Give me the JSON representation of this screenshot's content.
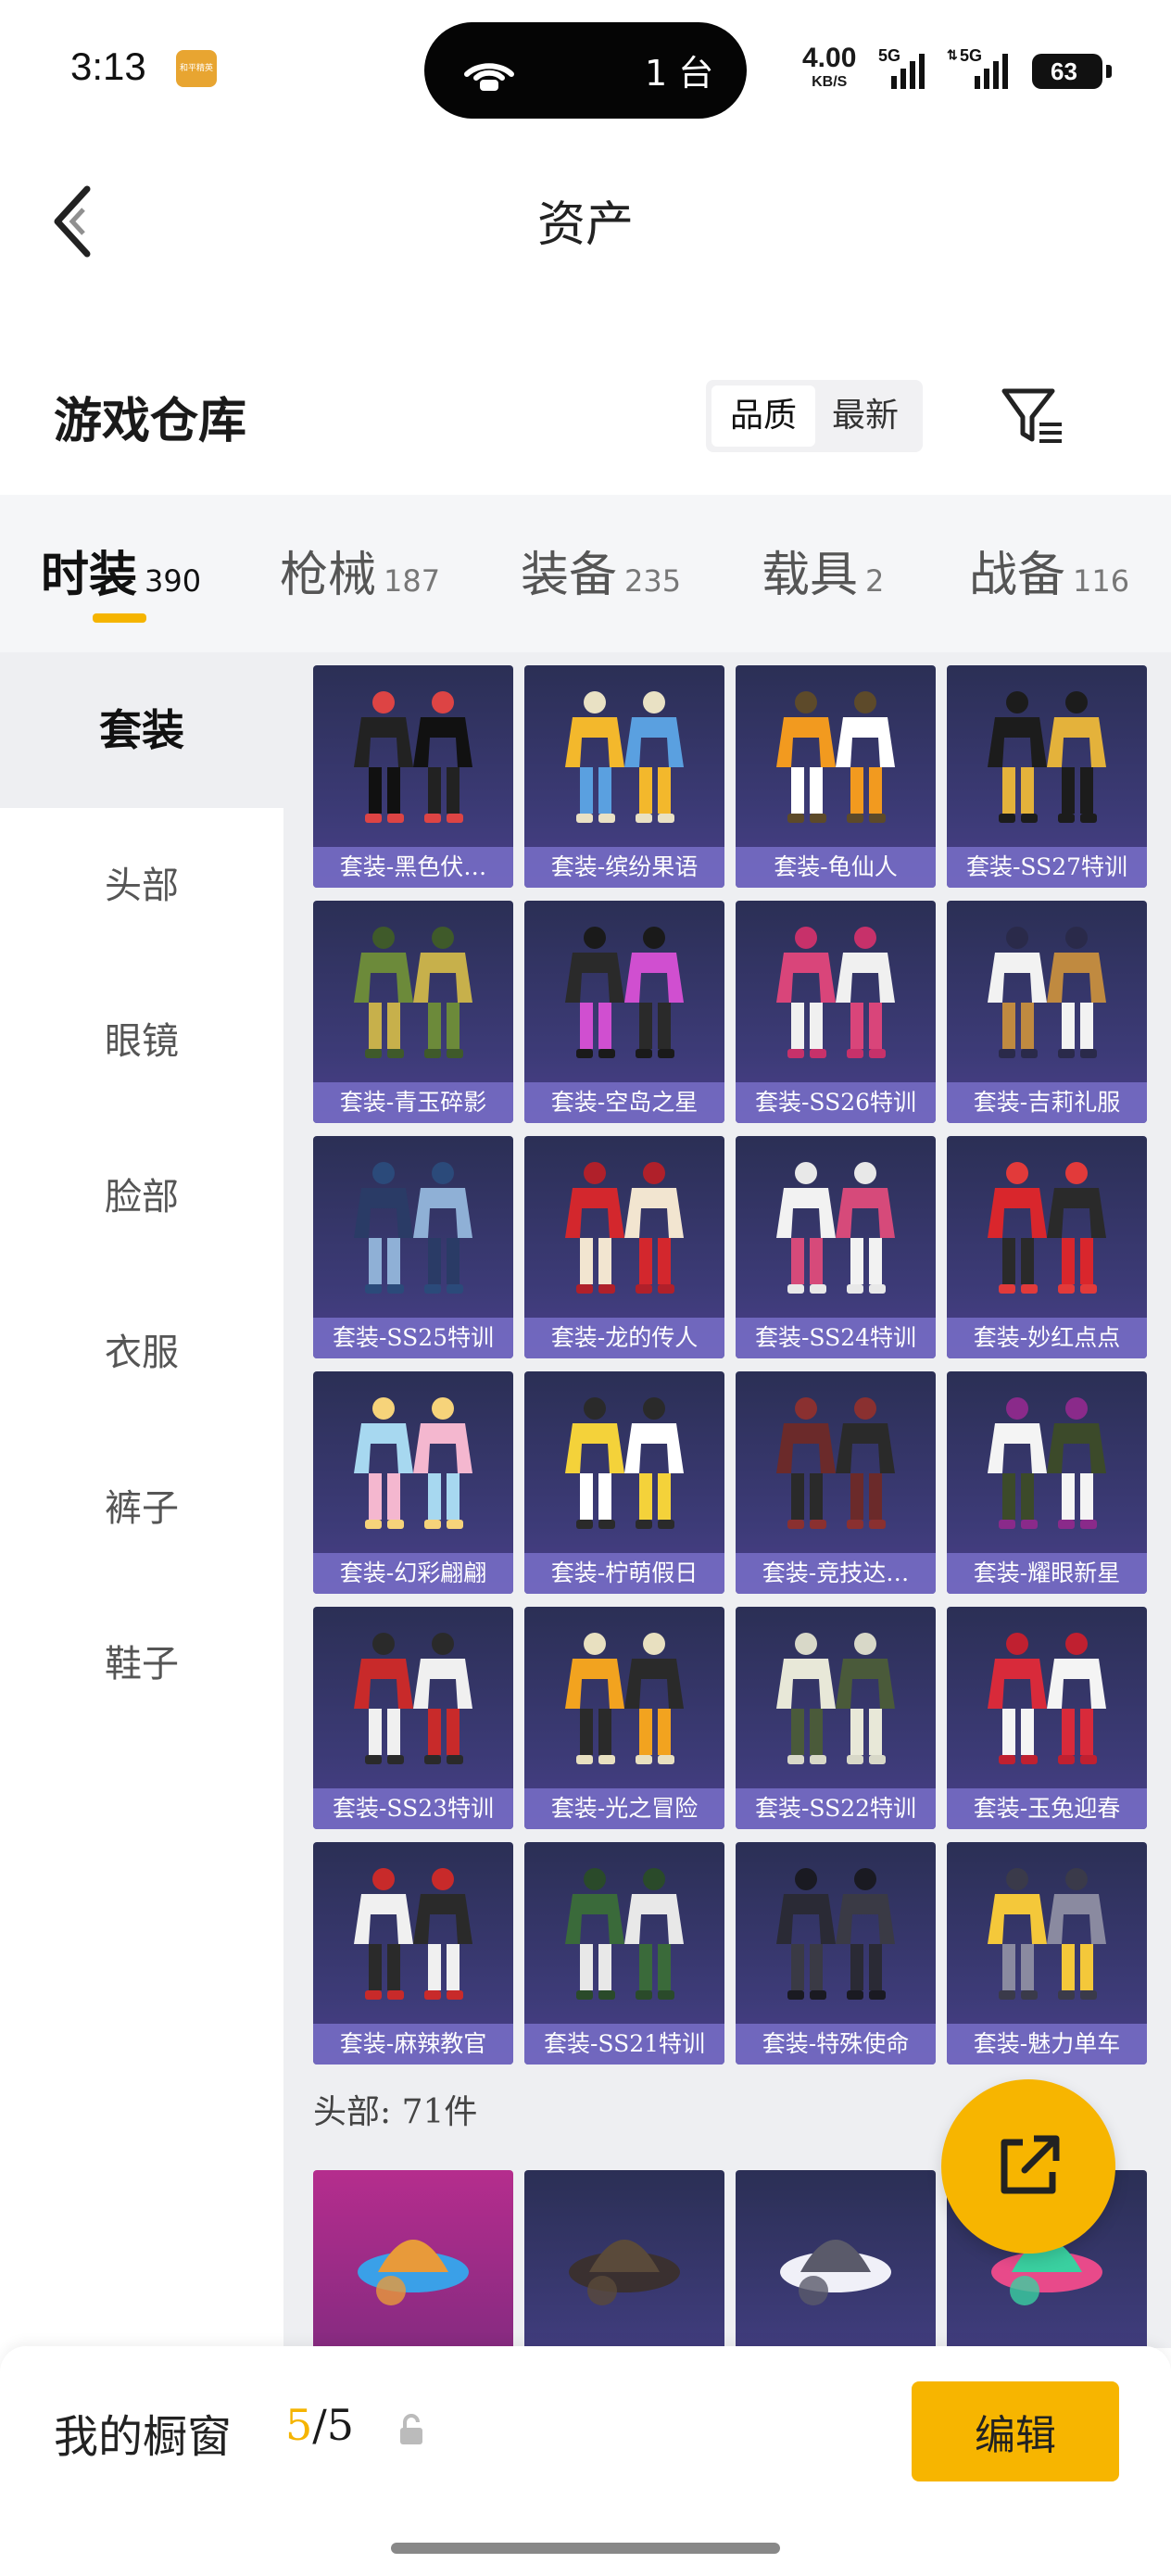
{
  "status": {
    "time": "3:13",
    "island_text": "1 台",
    "net_speed": "4.00",
    "net_unit": "KB/S",
    "sig1": "5G",
    "sig2": "5G",
    "battery": "63",
    "app_badge": "和平精英"
  },
  "header": {
    "title": "资产"
  },
  "section": {
    "title": "游戏仓库",
    "sort_options": [
      "品质",
      "最新"
    ],
    "sort_active": "品质"
  },
  "tabs": [
    {
      "label": "时装",
      "count": "390"
    },
    {
      "label": "枪械",
      "count": "187"
    },
    {
      "label": "装备",
      "count": "235"
    },
    {
      "label": "载具",
      "count": "2"
    },
    {
      "label": "战备",
      "count": "116"
    }
  ],
  "sidebar": [
    {
      "label": "套装"
    },
    {
      "label": "头部"
    },
    {
      "label": "眼镜"
    },
    {
      "label": "脸部"
    },
    {
      "label": "衣服"
    },
    {
      "label": "裤子"
    },
    {
      "label": "鞋子"
    }
  ],
  "items": [
    {
      "name": "套装-黑色伏…",
      "icon": "outfit-icon",
      "palette": [
        "#222",
        "#111",
        "#d44"
      ]
    },
    {
      "name": "套装-缤纷果语",
      "icon": "outfit-icon",
      "palette": [
        "#f3b82c",
        "#5aa0e0",
        "#e9e1c4"
      ]
    },
    {
      "name": "套装-龟仙人",
      "icon": "outfit-icon",
      "palette": [
        "#f29a1f",
        "#fff",
        "#5d4a2a"
      ]
    },
    {
      "name": "套装-SS27特训",
      "icon": "outfit-icon",
      "palette": [
        "#1c1c1c",
        "#e4b23b",
        "#1c1c1c"
      ]
    },
    {
      "name": "套装-青玉碎影",
      "icon": "outfit-icon",
      "palette": [
        "#6c8a3a",
        "#c7b04b",
        "#3f5a2a"
      ]
    },
    {
      "name": "套装-空岛之星",
      "icon": "outfit-icon",
      "palette": [
        "#2a2a2a",
        "#d04fd0",
        "#1a1a1a"
      ]
    },
    {
      "name": "套装-SS26特训",
      "icon": "outfit-icon",
      "palette": [
        "#d9457a",
        "#f0f0f0",
        "#c7316a"
      ]
    },
    {
      "name": "套装-吉莉礼服",
      "icon": "outfit-icon",
      "palette": [
        "#f2f2f2",
        "#c08a40",
        "#2a2a4a"
      ]
    },
    {
      "name": "套装-SS25特训",
      "icon": "outfit-icon",
      "palette": [
        "#2a3b66",
        "#8fb0d6",
        "#2b4a7a"
      ]
    },
    {
      "name": "套装-龙的传人",
      "icon": "outfit-icon",
      "palette": [
        "#d3272d",
        "#f2e5d0",
        "#b0202a"
      ]
    },
    {
      "name": "套装-SS24特训",
      "icon": "outfit-icon",
      "palette": [
        "#f2f2f2",
        "#d64a7a",
        "#e8e8e8"
      ]
    },
    {
      "name": "套装-妙红点点",
      "icon": "outfit-icon",
      "palette": [
        "#d9262c",
        "#2a2a2a",
        "#e23a3a"
      ]
    },
    {
      "name": "套装-幻彩翩翩",
      "icon": "outfit-icon",
      "palette": [
        "#a7d8f0",
        "#f4b7cf",
        "#f6d37a"
      ]
    },
    {
      "name": "套装-柠萌假日",
      "icon": "outfit-icon",
      "palette": [
        "#f4d23a",
        "#ffffff",
        "#2a2a2a"
      ]
    },
    {
      "name": "套装-竞技达…",
      "icon": "outfit-icon",
      "palette": [
        "#6b2a2a",
        "#2a2a2a",
        "#8a3030"
      ]
    },
    {
      "name": "套装-耀眼新星",
      "icon": "outfit-icon",
      "palette": [
        "#f4f4f4",
        "#3c4a2a",
        "#8a2a8a"
      ]
    },
    {
      "name": "套装-SS23特训",
      "icon": "outfit-icon",
      "palette": [
        "#c82a2a",
        "#f0f0f0",
        "#2a2a2a"
      ]
    },
    {
      "name": "套装-光之冒险",
      "icon": "outfit-icon",
      "palette": [
        "#f2a31f",
        "#2a2a2a",
        "#e8e0c0"
      ]
    },
    {
      "name": "套装-SS22特训",
      "icon": "outfit-icon",
      "palette": [
        "#e8e8d8",
        "#4a5a3a",
        "#d8d8c8"
      ]
    },
    {
      "name": "套装-玉兔迎春",
      "icon": "outfit-icon",
      "palette": [
        "#d82a3a",
        "#f4f4f4",
        "#c02030"
      ]
    },
    {
      "name": "套装-麻辣教官",
      "icon": "outfit-icon",
      "palette": [
        "#f0f0f0",
        "#2a2a2a",
        "#c82a2a"
      ]
    },
    {
      "name": "套装-SS21特训",
      "icon": "outfit-icon",
      "palette": [
        "#3a6a3a",
        "#e8e8e8",
        "#2a4a2a"
      ]
    },
    {
      "name": "套装-特殊使命",
      "icon": "outfit-icon",
      "palette": [
        "#2a2a35",
        "#3a3a45",
        "#1a1a22"
      ]
    },
    {
      "name": "套装-魅力单车",
      "icon": "outfit-icon",
      "palette": [
        "#f4c83a",
        "#8a8aa0",
        "#3a3a4a"
      ]
    }
  ],
  "sub_section": {
    "label": "头部: 71件"
  },
  "head_items": [
    {
      "icon": "helmet-icon",
      "palette": [
        "#3aa0e8",
        "#e89a3a"
      ]
    },
    {
      "icon": "hat-icon",
      "palette": [
        "#3a3030",
        "#5a4a3a"
      ]
    },
    {
      "icon": "hat-icon",
      "palette": [
        "#f0f0f8",
        "#5a5a6a"
      ]
    },
    {
      "icon": "wig-icon",
      "palette": [
        "#e84a8a",
        "#3ad0a0"
      ]
    }
  ],
  "fab": {
    "icon": "share-icon"
  },
  "bottom": {
    "label": "我的橱窗",
    "current": "5",
    "total": "/5",
    "edit_label": "编辑",
    "lock_icon": "lock-icon"
  },
  "colors": {
    "accent": "#f5b400",
    "card_top": "#2b2f55",
    "card_bottom": "#4b3f8a",
    "card_label_bar": "#786ec8"
  }
}
